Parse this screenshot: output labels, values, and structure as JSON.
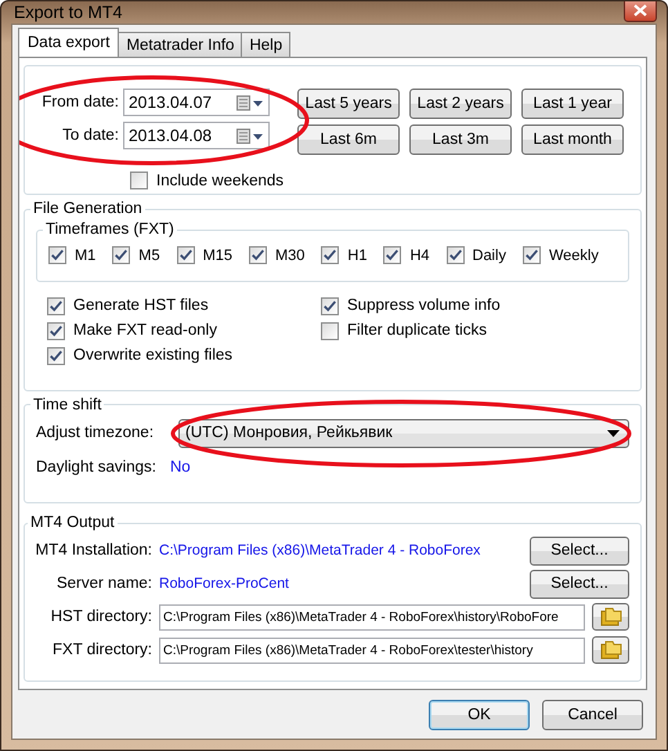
{
  "window": {
    "title": "Export to MT4"
  },
  "tabs": [
    {
      "label": "Data export",
      "selected": true
    },
    {
      "label": "Metatrader Info",
      "selected": false
    },
    {
      "label": "Help",
      "selected": false
    }
  ],
  "dates": [
    {
      "label": "From date:",
      "value": "2013.04.07"
    },
    {
      "label": "To date:",
      "value": "2013.04.08"
    }
  ],
  "range_buttons": [
    "Last 5 years",
    "Last 2 years",
    "Last 1 year",
    "Last 6m",
    "Last 3m",
    "Last month"
  ],
  "include_weekends": {
    "label": "Include weekends",
    "checked": false
  },
  "file_generation": {
    "title": "File Generation",
    "timeframes_title": "Timeframes (FXT)",
    "timeframes": [
      {
        "label": "M1",
        "checked": true
      },
      {
        "label": "M5",
        "checked": true
      },
      {
        "label": "M15",
        "checked": true
      },
      {
        "label": "M30",
        "checked": true
      },
      {
        "label": "H1",
        "checked": true
      },
      {
        "label": "H4",
        "checked": true
      },
      {
        "label": "Daily",
        "checked": true
      },
      {
        "label": "Weekly",
        "checked": true
      }
    ],
    "options": [
      {
        "label": "Generate HST files",
        "checked": true
      },
      {
        "label": "Make FXT read-only",
        "checked": true
      },
      {
        "label": "Overwrite existing files",
        "checked": true
      },
      {
        "label": "Suppress volume info",
        "checked": true
      },
      {
        "label": "Filter duplicate ticks",
        "checked": false
      }
    ]
  },
  "time_shift": {
    "title": "Time shift",
    "timezone_label": "Adjust timezone:",
    "timezone": "(UTC) Монровия, Рейкьявик",
    "daylight_label": "Daylight savings:",
    "daylight_value": "No"
  },
  "mt4_output": {
    "title": "MT4 Output",
    "links": [
      {
        "label": "MT4 Installation:",
        "value": "C:\\Program Files (x86)\\MetaTrader 4 - RoboForex",
        "button": "Select..."
      },
      {
        "label": "Server name:",
        "value": "RoboForex-ProCent",
        "button": "Select..."
      }
    ],
    "directories": [
      {
        "label": "HST directory:",
        "value": "C:\\Program Files (x86)\\MetaTrader 4 - RoboForex\\history\\RoboFore"
      },
      {
        "label": "FXT directory:",
        "value": "C:\\Program Files (x86)\\MetaTrader 4 - RoboForex\\tester\\history"
      }
    ]
  },
  "buttons": [
    {
      "label": "OK",
      "default": true
    },
    {
      "label": "Cancel",
      "default": false
    }
  ]
}
